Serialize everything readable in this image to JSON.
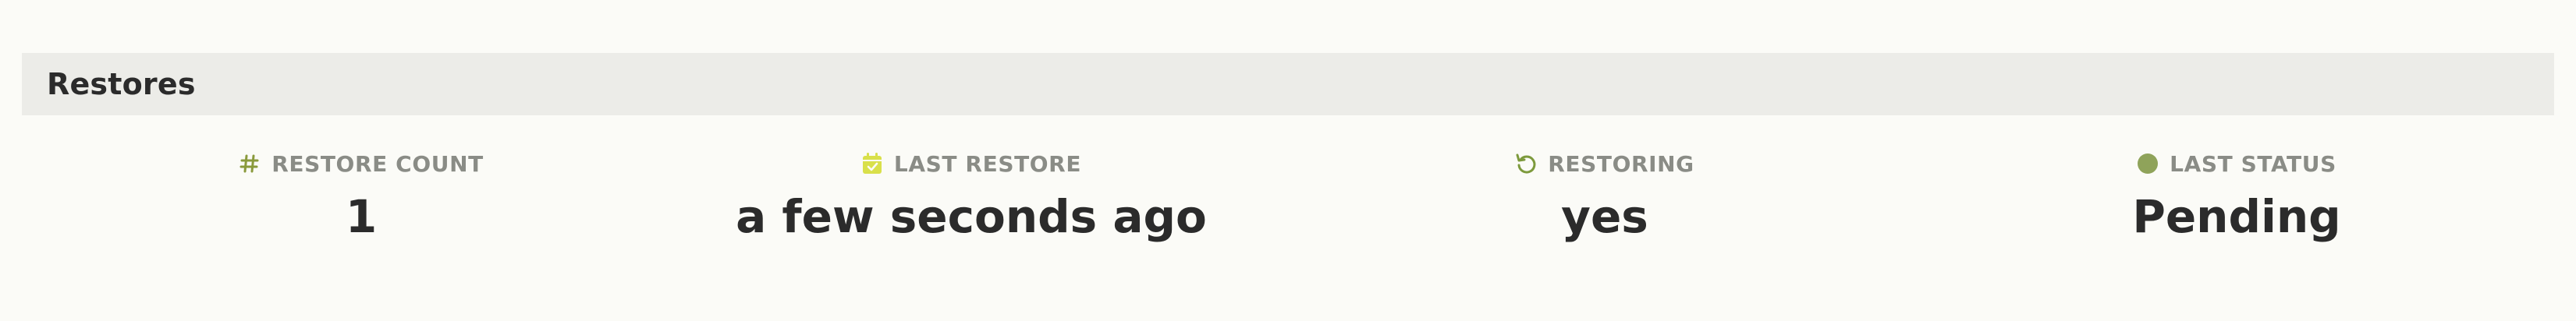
{
  "panel": {
    "title": "Restores"
  },
  "stats": [
    {
      "label": "RESTORE COUNT",
      "value": "1",
      "icon": "hash-icon",
      "icon_color": "#8a9a3c"
    },
    {
      "label": "LAST RESTORE",
      "value": "a few seconds ago",
      "icon": "calendar-check-icon",
      "icon_color": "#d9e04a"
    },
    {
      "label": "RESTORING",
      "value": "yes",
      "icon": "restore-arrow-icon",
      "icon_color": "#7d9a3c"
    },
    {
      "label": "LAST STATUS",
      "value": "Pending",
      "icon": "status-dot-icon",
      "icon_color": "#8fa35a"
    }
  ]
}
